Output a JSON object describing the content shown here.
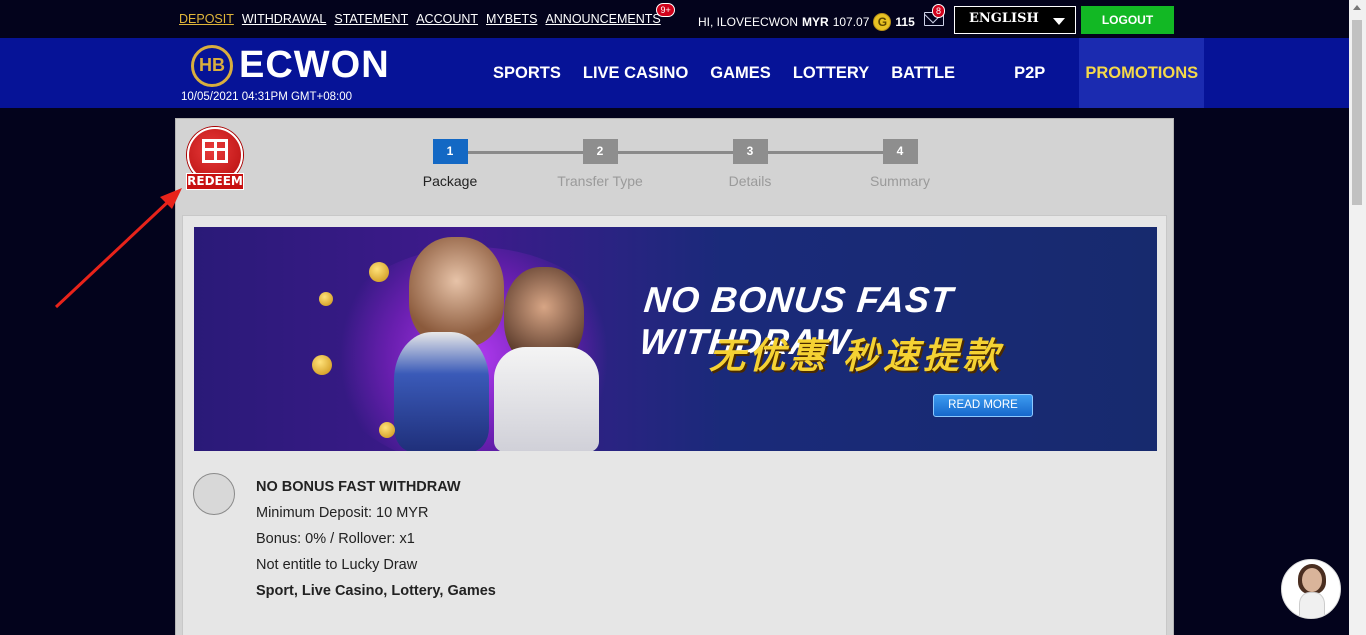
{
  "topbar": {
    "links": [
      {
        "label": "DEPOSIT",
        "active": true
      },
      {
        "label": "WITHDRAWAL",
        "active": false
      },
      {
        "label": "STATEMENT",
        "active": false
      },
      {
        "label": "ACCOUNT",
        "active": false
      },
      {
        "label": "MYBETS",
        "active": false
      },
      {
        "label": "ANNOUNCEMENTS",
        "active": false
      }
    ],
    "announcements_badge": "9+",
    "greeting": "HI, ILOVEECWON",
    "currency": "MYR",
    "balance": "107.07",
    "coin_letter": "G",
    "coin_amount": "115",
    "mail_badge": "8",
    "language": "ENGLISH",
    "logout_label": "LOGOUT"
  },
  "header": {
    "logo_text": "ECWON",
    "logo_mark": "HB",
    "datetime": "10/05/2021 04:31PM GMT+08:00",
    "nav": [
      "SPORTS",
      "LIVE CASINO",
      "GAMES",
      "LOTTERY",
      "BATTLE",
      "P2P",
      "PROMOTIONS"
    ],
    "active_nav": "PROMOTIONS"
  },
  "redeem": {
    "label": "REDEEM"
  },
  "steps": [
    {
      "num": "1",
      "name": "Package",
      "active": true
    },
    {
      "num": "2",
      "name": "Transfer Type",
      "active": false
    },
    {
      "num": "3",
      "name": "Details",
      "active": false
    },
    {
      "num": "4",
      "name": "Summary",
      "active": false
    }
  ],
  "banner": {
    "headline": "NO BONUS FAST WITHDRAW",
    "subline": "无优惠 秒速提款",
    "read_more": "READ MORE"
  },
  "package": {
    "title": "NO BONUS FAST WITHDRAW",
    "min_deposit": "Minimum Deposit: 10 MYR",
    "bonus": "Bonus: 0% / Rollover: x1",
    "lucky_draw": "Not entitle to Lucky Draw",
    "games": "Sport, Live Casino, Lottery, Games"
  },
  "colors": {
    "topbar_bg": "#03031c",
    "header_bg": "#061397",
    "accent_gold": "#e0b53a",
    "logout_green": "#12b824",
    "step_active": "#1368c4",
    "annotation_arrow": "#e8231a"
  },
  "icons": [
    "coin-icon",
    "mail-icon",
    "caret-down-icon",
    "gift-icon",
    "chat-avatar-icon"
  ]
}
